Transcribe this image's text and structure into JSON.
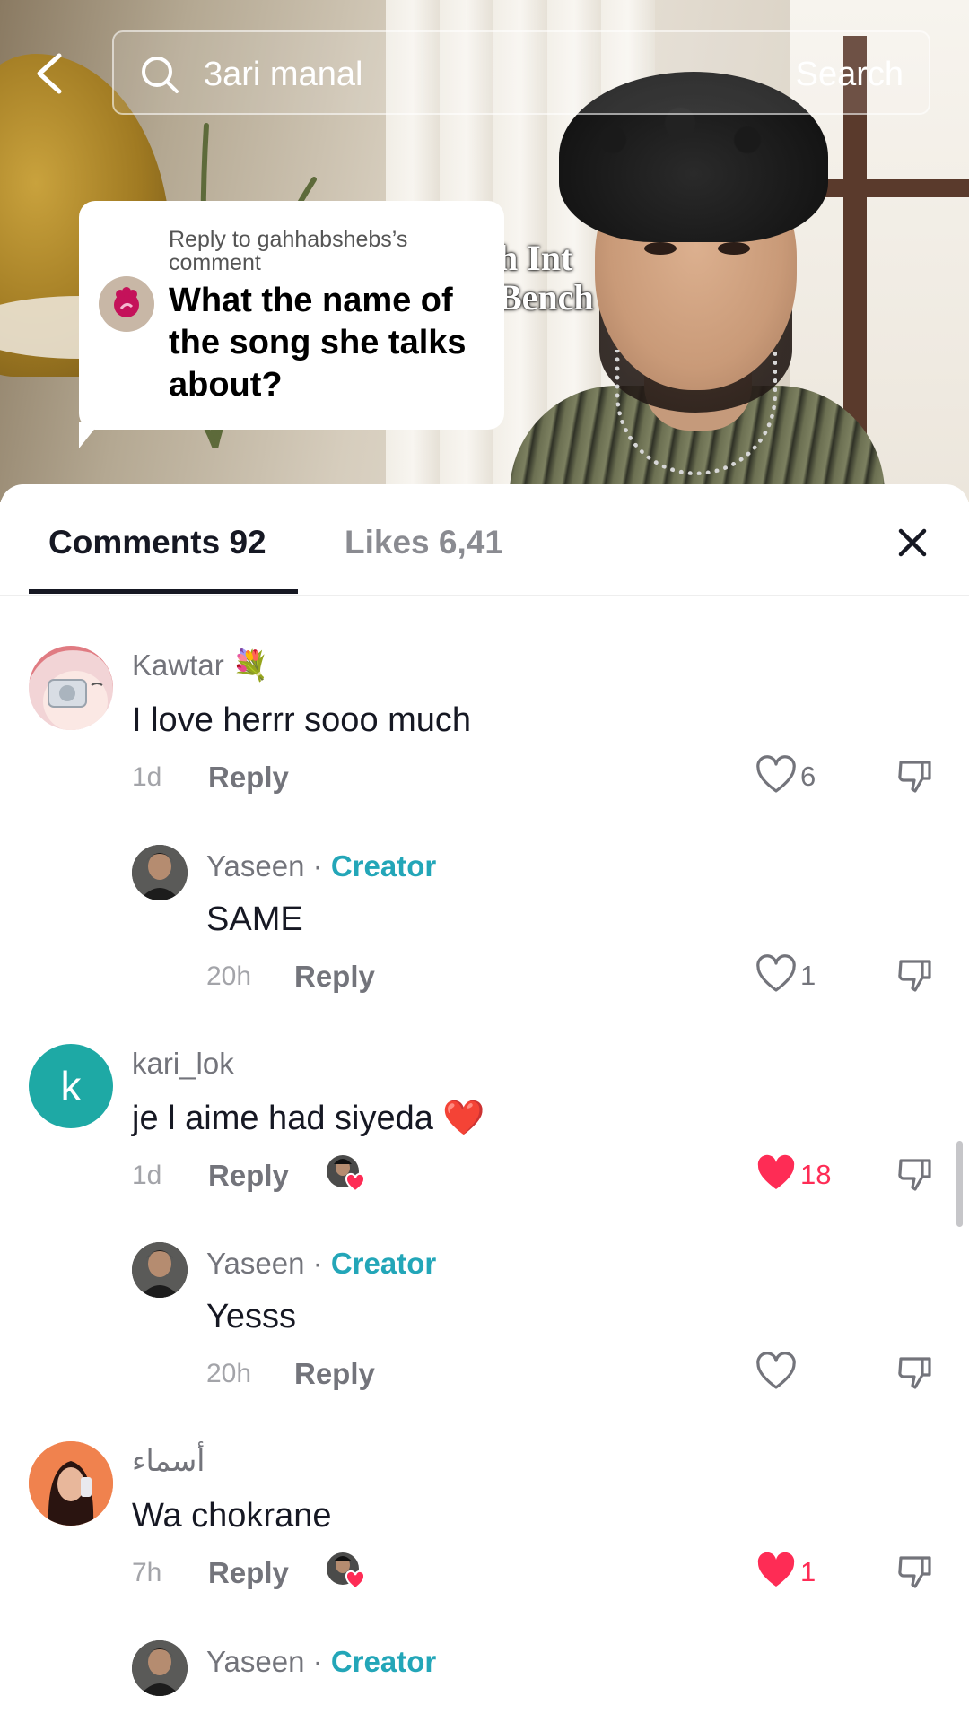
{
  "search": {
    "query": "3ari manal",
    "button_label": "Search"
  },
  "video": {
    "overlay_line1": "h Int",
    "overlay_line2": "Bench"
  },
  "reply_bubble": {
    "reply_to": "Reply to gahhabshebs’s comment",
    "text": "What the name of the song she talks about?"
  },
  "tabs": {
    "comments": "Comments 92",
    "likes": "Likes 6,41"
  },
  "comments": [
    {
      "username": "Kawtar",
      "emoji": "💐",
      "text": "I love herrr sooo much",
      "time": "1d",
      "reply_label": "Reply",
      "likes": "6",
      "liked": false
    },
    {
      "username": "Yaseen",
      "separator": "·",
      "badge": "Creator",
      "text": "SAME",
      "time": "20h",
      "reply_label": "Reply",
      "likes": "1",
      "liked": false
    },
    {
      "username": "kari_lok",
      "avatar_letter": "k",
      "text": "je l aime had siyeda",
      "emoji": "❤️",
      "time": "1d",
      "reply_label": "Reply",
      "likes": "18",
      "liked": true
    },
    {
      "username": "Yaseen",
      "separator": "·",
      "badge": "Creator",
      "text": "Yesss",
      "time": "20h",
      "reply_label": "Reply",
      "likes": "",
      "liked": false
    },
    {
      "username": "أسماء",
      "text": "Wa chokrane",
      "time": "7h",
      "reply_label": "Reply",
      "likes": "1",
      "liked": true
    },
    {
      "username": "Yaseen",
      "separator": "·",
      "badge": "Creator"
    }
  ],
  "colors": {
    "accent_creator": "#23a6b8",
    "like_red": "#fe2c55",
    "kari_avatar": "#1ea9a5"
  },
  "icons": [
    "back-arrow-icon",
    "search-icon",
    "close-icon",
    "heart-icon",
    "dislike-icon"
  ]
}
